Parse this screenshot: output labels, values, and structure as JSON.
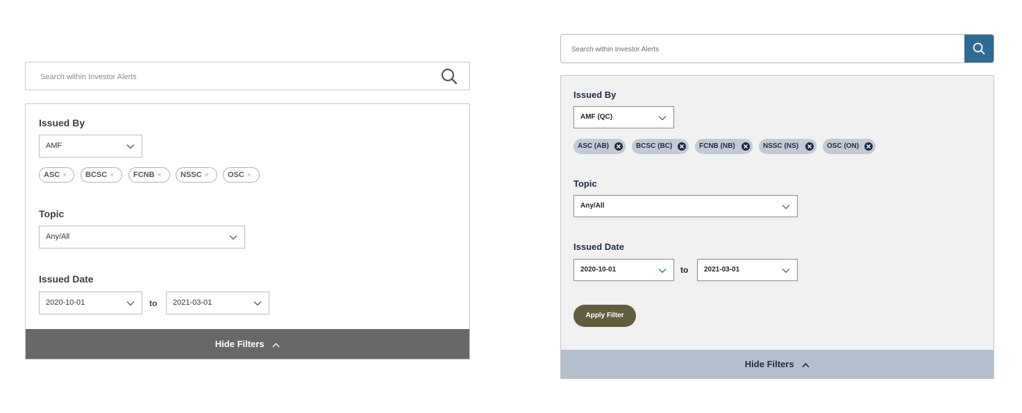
{
  "left_panel": {
    "search": {
      "placeholder": "Search within Investor Alerts",
      "icon": "search-icon"
    },
    "issued_by": {
      "label": "Issued By",
      "selected": "AMF",
      "chips": [
        "ASC",
        "BCSC",
        "FCNB",
        "NSSC",
        "OSC"
      ],
      "chip_remove_glyph": "×"
    },
    "topic": {
      "label": "Topic",
      "selected": "Any/All"
    },
    "issued_date": {
      "label": "Issued Date",
      "from": "2020-10-01",
      "to_label": "to",
      "to": "2021-03-01"
    },
    "hide_filters": "Hide Filters",
    "colors": {
      "footer_bg": "#686868",
      "border": "#c8c8c8"
    }
  },
  "right_panel": {
    "search": {
      "placeholder": "Search within Investor Alerts",
      "icon": "search-icon"
    },
    "issued_by": {
      "label": "Issued By",
      "selected": "AMF (QC)",
      "chips": [
        "ASC (AB)",
        "BCSC (BC)",
        "FCNB (NB)",
        "NSSC (NS)",
        "OSC (ON)"
      ]
    },
    "topic": {
      "label": "Topic",
      "selected": "Any/All"
    },
    "issued_date": {
      "label": "Issued Date",
      "from": "2020-10-01",
      "to_label": "to",
      "to": "2021-03-01"
    },
    "apply_filter": "Apply Filter",
    "hide_filters": "Hide Filters",
    "colors": {
      "search_button": "#2f6a92",
      "panel_bg": "#f1f1f1",
      "chip_bg": "#c4cad4",
      "chip_text": "#1e2b45",
      "apply_button": "#615e3f",
      "footer_bg": "#b5bfcb"
    }
  }
}
